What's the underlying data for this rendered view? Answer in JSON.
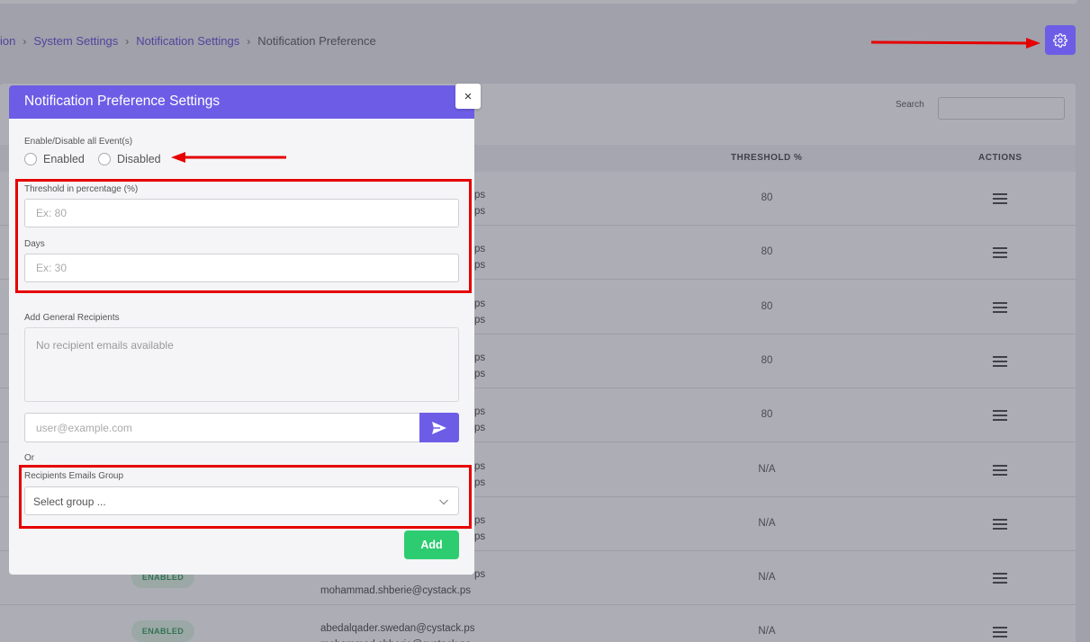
{
  "breadcrumb": {
    "items": [
      "ion",
      "System Settings",
      "Notification Settings"
    ],
    "current": "Notification Preference"
  },
  "search": {
    "label": "Search",
    "value": ""
  },
  "table": {
    "headers": {
      "threshold": "THRESHOLD %",
      "actions": "ACTIONS"
    },
    "rows": [
      {
        "status": "",
        "email1": "ps",
        "email2": "ps",
        "threshold": "80"
      },
      {
        "status": "",
        "email1": "ps",
        "email2": "ps",
        "threshold": "80"
      },
      {
        "status": "",
        "email1": "ps",
        "email2": "ps",
        "threshold": "80"
      },
      {
        "status": "",
        "email1": "ps",
        "email2": "ps",
        "threshold": "80"
      },
      {
        "status": "",
        "email1": "ps",
        "email2": "ps",
        "threshold": "80"
      },
      {
        "status": "",
        "email1": "ps",
        "email2": "ps",
        "threshold": "N/A"
      },
      {
        "status": "",
        "email1": "ps",
        "email2": "ps",
        "threshold": "N/A"
      },
      {
        "status": "ENABLED",
        "email1": "ps",
        "email2": "mohammad.shberie@cystack.ps",
        "threshold": "N/A"
      },
      {
        "status": "ENABLED",
        "email1": "abedalqader.swedan@cystack.ps",
        "email2": "mohammad.shberie@cystack.ps",
        "threshold": "N/A"
      }
    ]
  },
  "modal": {
    "title": "Notification Preference Settings",
    "close_label": "×",
    "toggle_label": "Enable/Disable all Event(s)",
    "enabled_label": "Enabled",
    "disabled_label": "Disabled",
    "threshold_label": "Threshold in percentage (%)",
    "threshold_placeholder": "Ex: 80",
    "days_label": "Days",
    "days_placeholder": "Ex: 30",
    "recipients_label": "Add General Recipients",
    "recipients_empty": "No recipient emails available",
    "email_placeholder": "user@example.com",
    "or_label": "Or",
    "group_label": "Recipients Emails Group",
    "group_placeholder": "Select group ...",
    "add_label": "Add"
  },
  "colors": {
    "accent": "#6d5de6",
    "success": "#2ecc71",
    "annotation": "#e60000"
  }
}
